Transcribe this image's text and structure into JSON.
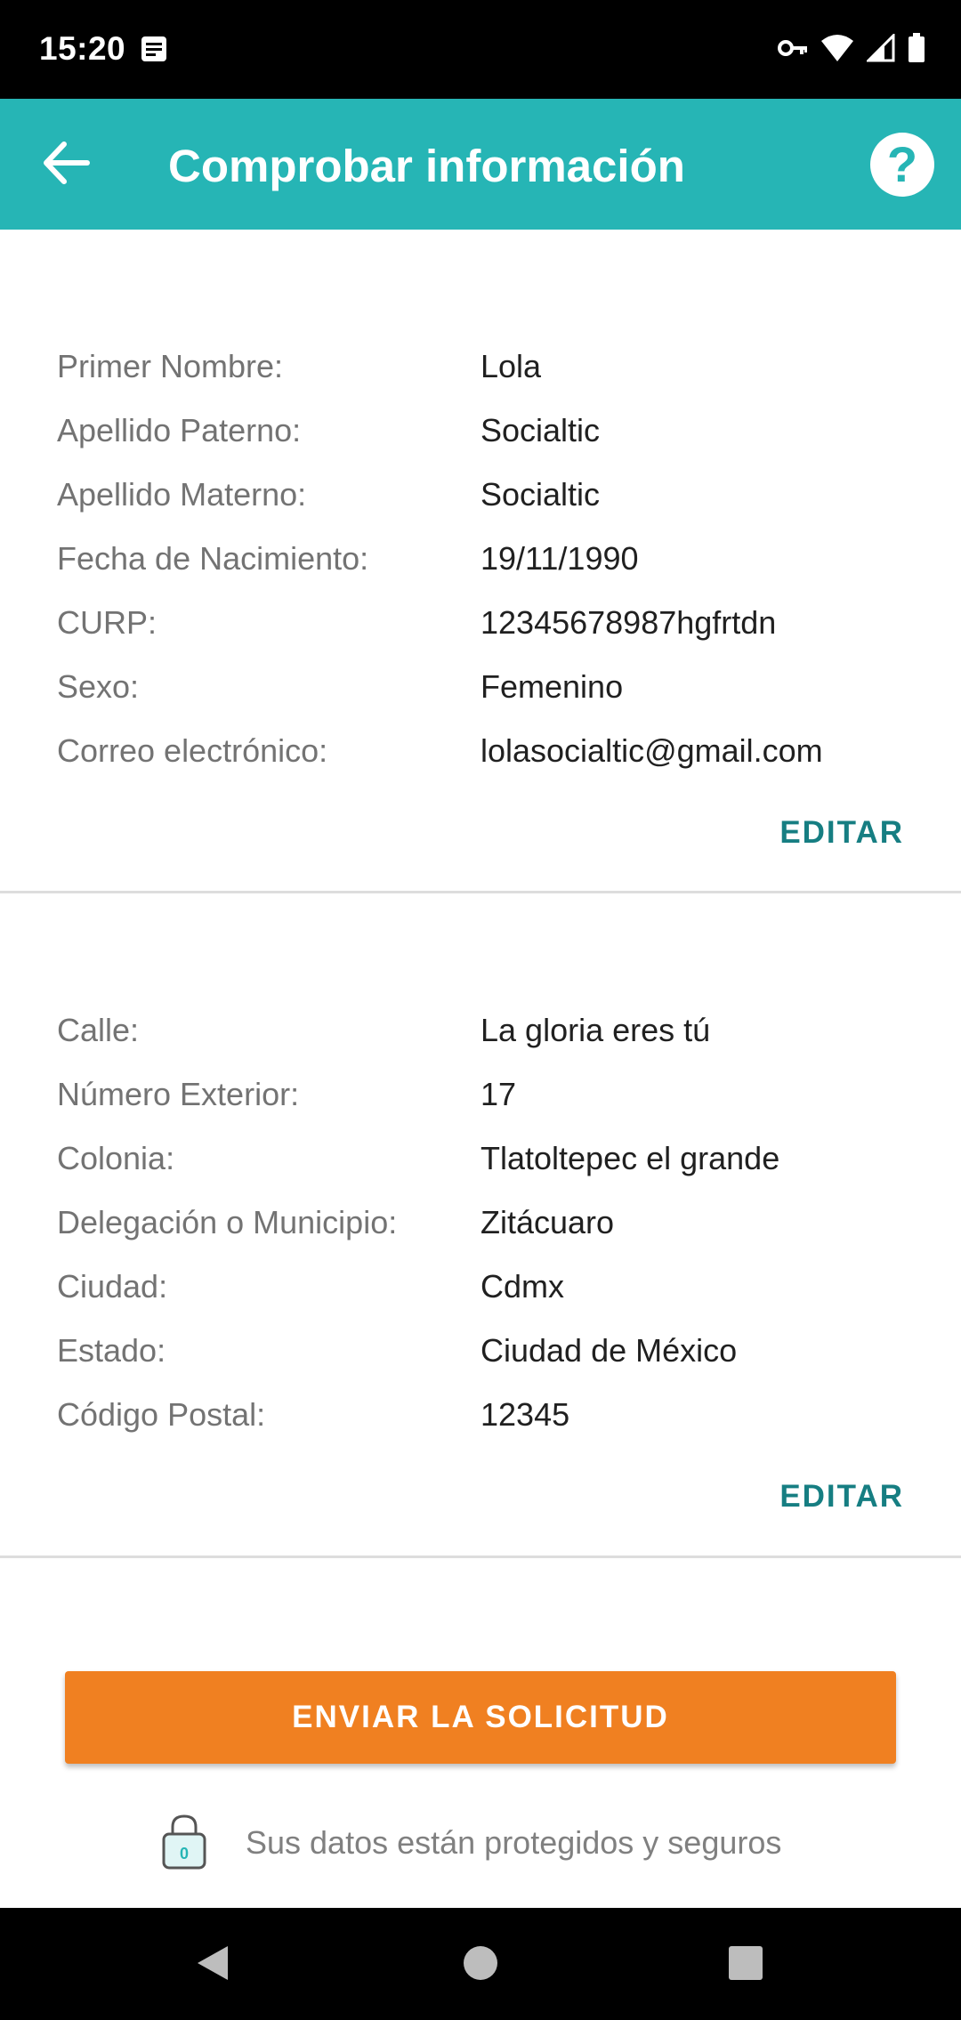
{
  "status_bar": {
    "time": "15:20"
  },
  "app_bar": {
    "title": "Comprobar información",
    "back_icon": "arrow-left-icon",
    "help_icon": "question-mark-icon"
  },
  "personal_section": {
    "rows": [
      {
        "label": "Primer Nombre:",
        "value": "Lola"
      },
      {
        "label": "Apellido Paterno:",
        "value": "Socialtic"
      },
      {
        "label": "Apellido Materno:",
        "value": "Socialtic"
      },
      {
        "label": "Fecha de Nacimiento:",
        "value": "19/11/1990"
      },
      {
        "label": "CURP:",
        "value": "12345678987hgfrtdn"
      },
      {
        "label": "Sexo:",
        "value": "Femenino"
      },
      {
        "label": "Correo electrónico:",
        "value": "lolasocialtic@gmail.com"
      }
    ],
    "edit_label": "EDITAR"
  },
  "address_section": {
    "rows": [
      {
        "label": "Calle:",
        "value": "La gloria eres tú"
      },
      {
        "label": "Número Exterior:",
        "value": "17"
      },
      {
        "label": "Colonia:",
        "value": "Tlatoltepec el grande"
      },
      {
        "label": "Delegación o Municipio:",
        "value": "Zitácuaro"
      },
      {
        "label": "Ciudad:",
        "value": "Cdmx"
      },
      {
        "label": "Estado:",
        "value": "Ciudad de México"
      },
      {
        "label": "Código Postal:",
        "value": "12345"
      }
    ],
    "edit_label": "EDITAR"
  },
  "submit": {
    "label": "ENVIAR LA SOLICITUD"
  },
  "security_note": {
    "icon": "padlock-icon",
    "lock_digit": "0",
    "text": "Sus datos están protegidos y seguros"
  },
  "colors": {
    "app_bar": "#26b5b5",
    "accent_text": "#167e82",
    "submit_button": "#f08021"
  }
}
